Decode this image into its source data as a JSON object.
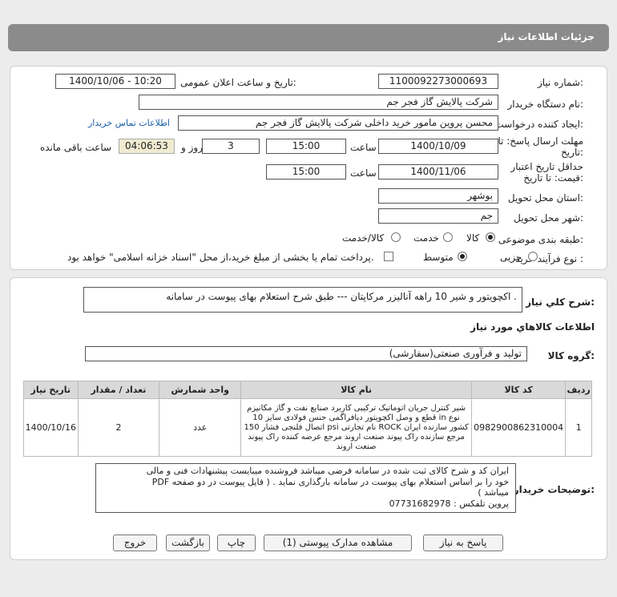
{
  "page_title": "جزئیات اطلاعات نیاز",
  "need_number": {
    "label": "شماره نیاز:",
    "value": "1100092273000693"
  },
  "announce": {
    "label": "تاریخ و ساعت اعلان عمومی:",
    "value": "1400/10/06 - 10:20"
  },
  "buyer_org": {
    "label": "نام دستگاه خریدار:",
    "value": "شرکت پالایش گاز فجر جم"
  },
  "requester": {
    "label": "ایجاد کننده درخواست:",
    "value": "محسن پروین مامور خرید داخلی شرکت پالایش گاز فجر جم",
    "contact_link": "اطلاعات تماس خریدار"
  },
  "deadline": {
    "label_line1": "مهلت ارسال پاسخ: تا",
    "label_line2": "تاریخ:",
    "date": "1400/10/09",
    "time_label": "ساعت",
    "time": "15:00",
    "days": "3",
    "days_label": "روز و",
    "remaining": "04:06:53",
    "remaining_label": "ساعت باقی مانده"
  },
  "validity": {
    "label_line1": "حداقل تاریخ اعتبار",
    "label_line2": "قیمت: تا تاریخ:",
    "date": "1400/11/06",
    "time_label": "ساعت",
    "time": "15:00"
  },
  "province": {
    "label": "استان محل تحویل:",
    "value": "بوشهر"
  },
  "city": {
    "label": "شهر محل تحویل:",
    "value": "جم"
  },
  "category": {
    "label": "طبقه بندی موضوعی:",
    "options": [
      "کالا",
      "خدمت",
      "کالا/خدمت"
    ],
    "selected": 0
  },
  "process": {
    "label": "نوع فرآیند خرید :",
    "options": [
      "جزیی",
      "متوسط"
    ],
    "selected": 1,
    "payment_note": "پرداخت تمام یا بخشی از مبلغ خرید،از محل \"اسناد خزانه اسلامی\" خواهد بود."
  },
  "summary": {
    "label": "شرح کلي نياز:",
    "value": "اکچویتور و شیر 10 راهه آنالیزر مرکاپتان --- طبق شرح استعلام بهای پیوست در سامانه ."
  },
  "goods_info_title": "اطلاعات کالاهاي مورد نياز",
  "goods_group": {
    "label": "گروه کالا:",
    "value": "تولید و فرآوری صنعتی(سفارشی)"
  },
  "table": {
    "headers": [
      "ردیف",
      "کد کالا",
      "نام کالا",
      "واحد شمارش",
      "تعداد / مقدار",
      "تاریخ نیاز"
    ],
    "rows": [
      {
        "row": "1",
        "code": "0982900862310004",
        "name": "شیر کنترل جریان اتوماتیک ترکیبی کاربرد صنایع نفت و گاز مکانیزم قطع و وصل اکچویتور دیافراگمی جنس فولادی سایز 10 in نوع اتصال فلنجی فشار 150 psi نام تجارتی ROCK کشور سازنده ایران مرجع سازنده راک پیوند صنعت اروند مرجع عرضه کننده راک پیوند صنعت اروند",
        "unit": "عدد",
        "qty": "2",
        "date": "1400/10/16"
      }
    ]
  },
  "buyer_notes": {
    "label": "توضیحات خریدار:",
    "line1": "ایران کد و شرح کالای ثبت شده در سامانه فرضی میباشد فروشنده میبایست پیشنهادات فنی و مالی",
    "line2": "خود را بر اساس استعلام بهای پیوست در سامانه بارگذاری نماید . ( فایل پیوست در دو صفحه PDF",
    "line3": "میباشد )",
    "line4": "پروین    تلفکس : 07731682978"
  },
  "buttons": {
    "reply": "پاسخ به نیاز",
    "docs": "مشاهده مدارک پیوستی (1)",
    "print": "چاپ",
    "back": "بازگشت",
    "exit": "خروج"
  }
}
